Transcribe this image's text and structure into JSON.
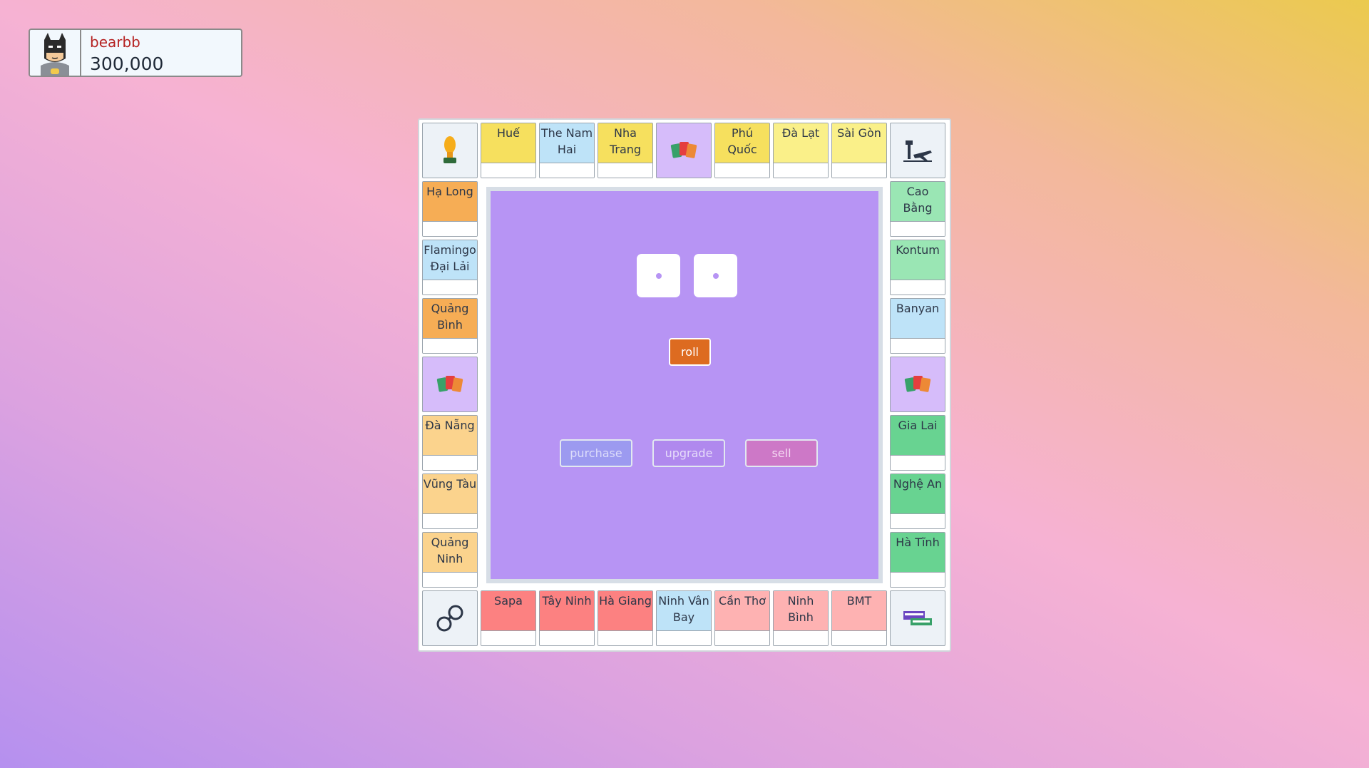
{
  "player": {
    "name": "bearbb",
    "money": "300,000",
    "avatar_icon": "batman-avatar-icon"
  },
  "board": {
    "top_row": [
      {
        "kind": "corner",
        "icon": "trophy-icon"
      },
      {
        "kind": "property",
        "name": "Huế",
        "color": "#f6e05e"
      },
      {
        "kind": "property",
        "name": "The Nam Hai",
        "color": "#bee3f8"
      },
      {
        "kind": "property",
        "name": "Nha Trang",
        "color": "#f6e05e"
      },
      {
        "kind": "card",
        "icon": "cards-icon"
      },
      {
        "kind": "property",
        "name": "Phú Quốc",
        "color": "#f6e05e"
      },
      {
        "kind": "property",
        "name": "Đà Lạt",
        "color": "#faf089"
      },
      {
        "kind": "property",
        "name": "Sài Gòn",
        "color": "#faf089"
      },
      {
        "kind": "corner",
        "icon": "airport-icon"
      }
    ],
    "left_col": [
      {
        "kind": "property",
        "name": "Hạ Long",
        "color": "#f6ad55"
      },
      {
        "kind": "property",
        "name": "Flamingo Đại Lải",
        "color": "#bee3f8"
      },
      {
        "kind": "property",
        "name": "Quảng Bình",
        "color": "#f6ad55"
      },
      {
        "kind": "card",
        "icon": "cards-icon"
      },
      {
        "kind": "property",
        "name": "Đà Nẵng",
        "color": "#fbd38d"
      },
      {
        "kind": "property",
        "name": "Vũng Tàu",
        "color": "#fbd38d"
      },
      {
        "kind": "property",
        "name": "Quảng Ninh",
        "color": "#fbd38d"
      }
    ],
    "right_col": [
      {
        "kind": "property",
        "name": "Cao Bằng",
        "color": "#9ae6b4"
      },
      {
        "kind": "property",
        "name": "Kontum",
        "color": "#9ae6b4"
      },
      {
        "kind": "property",
        "name": "Banyan",
        "color": "#bee3f8"
      },
      {
        "kind": "card",
        "icon": "cards-icon"
      },
      {
        "kind": "property",
        "name": "Gia Lai",
        "color": "#68d391"
      },
      {
        "kind": "property",
        "name": "Nghệ An",
        "color": "#68d391"
      },
      {
        "kind": "property",
        "name": "Hà Tĩnh",
        "color": "#68d391"
      }
    ],
    "bottom_row": [
      {
        "kind": "corner",
        "icon": "handcuffs-icon"
      },
      {
        "kind": "property",
        "name": "Sapa",
        "color": "#fc8181"
      },
      {
        "kind": "property",
        "name": "Tây Ninh",
        "color": "#fc8181"
      },
      {
        "kind": "property",
        "name": "Hà Giang",
        "color": "#fc8181"
      },
      {
        "kind": "property",
        "name": "Ninh Vân Bay",
        "color": "#bee3f8"
      },
      {
        "kind": "property",
        "name": "Cần Thơ",
        "color": "#feb2b2"
      },
      {
        "kind": "property",
        "name": "Ninh Bình",
        "color": "#feb2b2"
      },
      {
        "kind": "property",
        "name": "BMT",
        "color": "#feb2b2"
      },
      {
        "kind": "corner",
        "icon": "lets-go-start-icon"
      }
    ]
  },
  "dice": [
    1,
    1
  ],
  "controls": {
    "roll": "roll",
    "purchase": "purchase",
    "upgrade": "upgrade",
    "sell": "sell"
  }
}
